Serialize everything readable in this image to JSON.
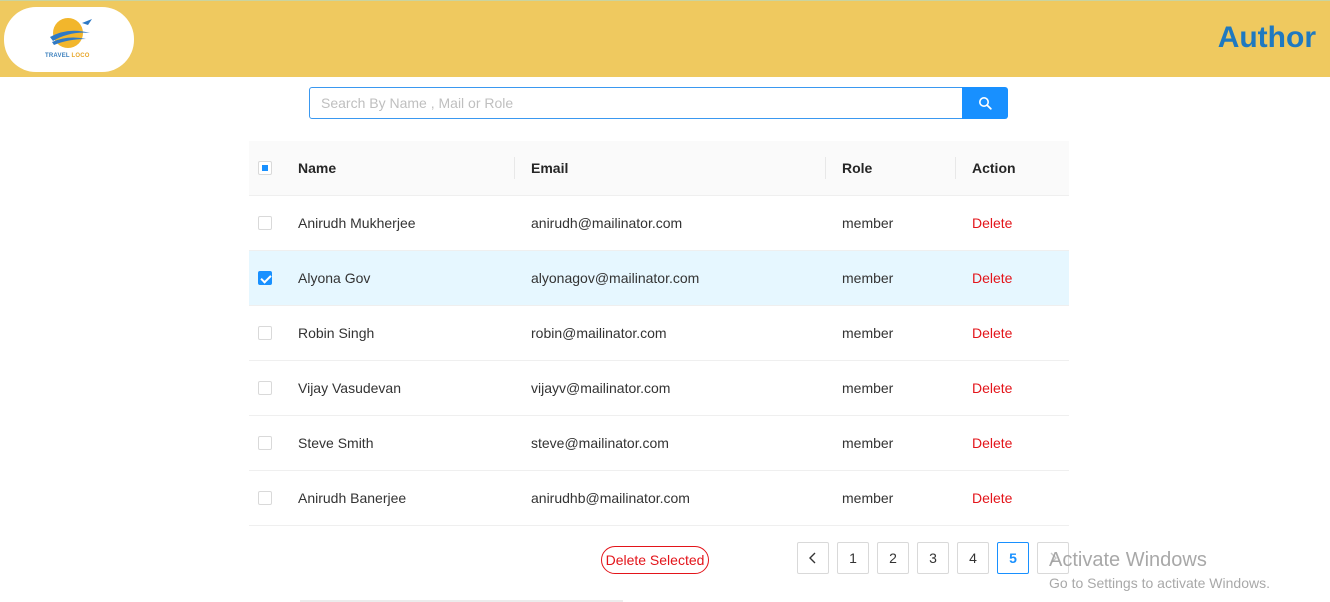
{
  "header": {
    "logo": {
      "text_part1": "TRAVEL",
      "text_part2": "LOCO",
      "icon": "travel-loco-logo"
    },
    "title": "Author",
    "background": "#efc95f",
    "title_color": "#1f79c0"
  },
  "search": {
    "placeholder": "Search By Name , Mail or Role",
    "value": "",
    "button_icon": "search-icon",
    "accent": "#1890ff"
  },
  "table": {
    "columns": [
      "Name",
      "Email",
      "Role",
      "Action"
    ],
    "header_checkbox": "indeterminate",
    "rows": [
      {
        "name": "Anirudh Mukherjee",
        "email": "anirudh@mailinator.com",
        "role": "member",
        "action": "Delete",
        "checked": false
      },
      {
        "name": "Alyona Gov",
        "email": "alyonagov@mailinator.com",
        "role": "member",
        "action": "Delete",
        "checked": true
      },
      {
        "name": "Robin Singh",
        "email": "robin@mailinator.com",
        "role": "member",
        "action": "Delete",
        "checked": false
      },
      {
        "name": "Vijay Vasudevan",
        "email": "vijayv@mailinator.com",
        "role": "member",
        "action": "Delete",
        "checked": false
      },
      {
        "name": "Steve Smith",
        "email": "steve@mailinator.com",
        "role": "member",
        "action": "Delete",
        "checked": false
      },
      {
        "name": "Anirudh Banerjee",
        "email": "anirudhb@mailinator.com",
        "role": "member",
        "action": "Delete",
        "checked": false
      }
    ]
  },
  "actions": {
    "delete_selected_label": "Delete Selected",
    "danger_color": "#e3141a"
  },
  "pagination": {
    "prev_icon": "chevron-left-icon",
    "next_icon": "chevron-right-icon",
    "pages": [
      "1",
      "2",
      "3",
      "4",
      "5"
    ],
    "current": "5"
  },
  "watermark": {
    "title": "Activate Windows",
    "subtitle": "Go to Settings to activate Windows."
  }
}
